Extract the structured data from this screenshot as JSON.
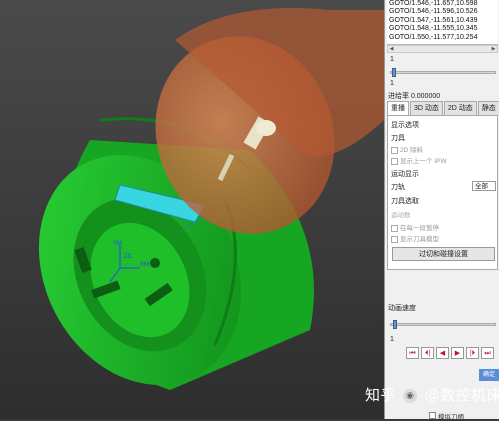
{
  "gcode_lines": [
    "GOTO/1.546,-11.657,10.598",
    "GOTO/1.546,-11.596,10.526",
    "GOTO/1.547,-11.561,10.439",
    "GOTO/1.548,-11.555,10.345",
    "GOTO/1.550,-11.577,10.254"
  ],
  "slider_top": {
    "min_label": "1",
    "max_label": "1",
    "value": 0.02
  },
  "feed_rate_label": "进给率 0.000000",
  "tabs": [
    "重播",
    "3D 动态",
    "2D 动态",
    "静态"
  ],
  "active_tab": 0,
  "tab_body": {
    "display_options": "显示选项",
    "tool": "刀具",
    "cb_2d_material": "2D 除料",
    "cb_show_prev_ipw": "显示上一个 IPW",
    "motion_display": "运动显示",
    "tool_path_label": "刀轨",
    "tool_path_value": "全部",
    "tool_filter": "刀具选取",
    "motion_count": "运动数",
    "cb_stop_each": "在每一段暂停",
    "cb_show_3d_tool": "显示刀具模型",
    "button_settings": "过切和碰撞设置"
  },
  "anim_speed": {
    "label": "动画速度",
    "value_label": "1",
    "value": 0.04
  },
  "player_buttons": [
    "⏮",
    "⏴|",
    "◀",
    "▶",
    "|⏵",
    "⏭"
  ],
  "confirm_label": "确定",
  "watermark": {
    "prefix": "知乎",
    "handle": "@数控机床猫"
  },
  "lathe_cb": "模拟刀柄",
  "axes": {
    "x": "XM",
    "y": "YM",
    "z": "ZC"
  },
  "colors": {
    "part": "#1fbf2a",
    "part_dark": "#117a18",
    "tool_holder": "#c86a3c",
    "highlight": "#38d6e0"
  }
}
